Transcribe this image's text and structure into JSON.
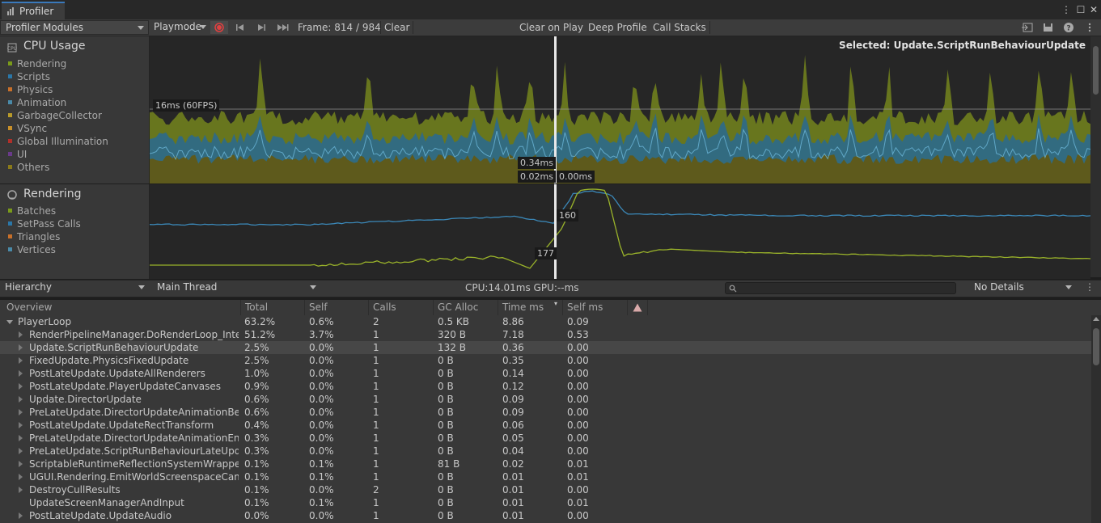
{
  "window": {
    "tab_title": "Profiler"
  },
  "toolbar": {
    "modules_label": "Profiler Modules",
    "mode_label": "Playmode",
    "frame_label": "Frame: 814 / 984",
    "clear_label": "Clear",
    "clear_on_play_label": "Clear on Play",
    "deep_profile_label": "Deep Profile",
    "call_stacks_label": "Call Stacks"
  },
  "cpu_module": {
    "title": "CPU Usage",
    "legend": [
      {
        "label": "Rendering",
        "color": "#7a9a1a"
      },
      {
        "label": "Scripts",
        "color": "#2b77a8"
      },
      {
        "label": "Physics",
        "color": "#c8702a"
      },
      {
        "label": "Animation",
        "color": "#4a8aa8"
      },
      {
        "label": "GarbageCollector",
        "color": "#b89a2a"
      },
      {
        "label": "VSync",
        "color": "#c8902a"
      },
      {
        "label": "Global Illumination",
        "color": "#b0302a"
      },
      {
        "label": "UI",
        "color": "#6a3a8a"
      },
      {
        "label": "Others",
        "color": "#8a7a1a"
      }
    ],
    "selected_label": "Selected: Update.ScriptRunBehaviourUpdate",
    "fps_line_label": "16ms (60FPS)",
    "marker_labels": [
      "0.34ms",
      "0.02ms",
      "0.00ms"
    ]
  },
  "rendering_module": {
    "title": "Rendering",
    "legend": [
      {
        "label": "Batches",
        "color": "#7a9a1a"
      },
      {
        "label": "SetPass Calls",
        "color": "#2b77a8"
      },
      {
        "label": "Triangles",
        "color": "#c8702a"
      },
      {
        "label": "Vertices",
        "color": "#4a8aa8"
      }
    ],
    "marker_labels": [
      "160",
      "177"
    ]
  },
  "hierarchy_toolbar": {
    "view_label": "Hierarchy",
    "thread_label": "Main Thread",
    "timing_label": "CPU:14.01ms  GPU:--ms",
    "details_label": "No Details"
  },
  "table": {
    "columns": [
      "Overview",
      "Total",
      "Self",
      "Calls",
      "GC Alloc",
      "Time ms",
      "Self ms"
    ],
    "rows": [
      {
        "name": "PlayerLoop",
        "total": "63.2%",
        "self": "0.6%",
        "calls": "2",
        "gc": "0.5 KB",
        "time": "8.86",
        "selfms": "0.09",
        "expand": "open",
        "indent": 0
      },
      {
        "name": "RenderPipelineManager.DoRenderLoop_Intern",
        "total": "51.2%",
        "self": "3.7%",
        "calls": "1",
        "gc": "320 B",
        "time": "7.18",
        "selfms": "0.53",
        "expand": "closed",
        "indent": 1
      },
      {
        "name": "Update.ScriptRunBehaviourUpdate",
        "total": "2.5%",
        "self": "0.0%",
        "calls": "1",
        "gc": "132 B",
        "time": "0.36",
        "selfms": "0.00",
        "expand": "closed",
        "indent": 1,
        "selected": true
      },
      {
        "name": "FixedUpdate.PhysicsFixedUpdate",
        "total": "2.5%",
        "self": "0.0%",
        "calls": "1",
        "gc": "0 B",
        "time": "0.35",
        "selfms": "0.00",
        "expand": "closed",
        "indent": 1
      },
      {
        "name": "PostLateUpdate.UpdateAllRenderers",
        "total": "1.0%",
        "self": "0.0%",
        "calls": "1",
        "gc": "0 B",
        "time": "0.14",
        "selfms": "0.00",
        "expand": "closed",
        "indent": 1
      },
      {
        "name": "PostLateUpdate.PlayerUpdateCanvases",
        "total": "0.9%",
        "self": "0.0%",
        "calls": "1",
        "gc": "0 B",
        "time": "0.12",
        "selfms": "0.00",
        "expand": "closed",
        "indent": 1
      },
      {
        "name": "Update.DirectorUpdate",
        "total": "0.6%",
        "self": "0.0%",
        "calls": "1",
        "gc": "0 B",
        "time": "0.09",
        "selfms": "0.00",
        "expand": "closed",
        "indent": 1
      },
      {
        "name": "PreLateUpdate.DirectorUpdateAnimationBegin",
        "total": "0.6%",
        "self": "0.0%",
        "calls": "1",
        "gc": "0 B",
        "time": "0.09",
        "selfms": "0.00",
        "expand": "closed",
        "indent": 1
      },
      {
        "name": "PostLateUpdate.UpdateRectTransform",
        "total": "0.4%",
        "self": "0.0%",
        "calls": "1",
        "gc": "0 B",
        "time": "0.06",
        "selfms": "0.00",
        "expand": "closed",
        "indent": 1
      },
      {
        "name": "PreLateUpdate.DirectorUpdateAnimationEnd",
        "total": "0.3%",
        "self": "0.0%",
        "calls": "1",
        "gc": "0 B",
        "time": "0.05",
        "selfms": "0.00",
        "expand": "closed",
        "indent": 1
      },
      {
        "name": "PreLateUpdate.ScriptRunBehaviourLateUpdate",
        "total": "0.3%",
        "self": "0.0%",
        "calls": "1",
        "gc": "0 B",
        "time": "0.04",
        "selfms": "0.00",
        "expand": "closed",
        "indent": 1
      },
      {
        "name": "ScriptableRuntimeReflectionSystemWrapper.Ir",
        "total": "0.1%",
        "self": "0.1%",
        "calls": "1",
        "gc": "81 B",
        "time": "0.02",
        "selfms": "0.01",
        "expand": "closed",
        "indent": 1
      },
      {
        "name": "UGUI.Rendering.EmitWorldScreenspaceCamer",
        "total": "0.1%",
        "self": "0.1%",
        "calls": "1",
        "gc": "0 B",
        "time": "0.01",
        "selfms": "0.01",
        "expand": "closed",
        "indent": 1
      },
      {
        "name": "DestroyCullResults",
        "total": "0.1%",
        "self": "0.0%",
        "calls": "2",
        "gc": "0 B",
        "time": "0.01",
        "selfms": "0.00",
        "expand": "closed",
        "indent": 1
      },
      {
        "name": "UpdateScreenManagerAndInput",
        "total": "0.1%",
        "self": "0.1%",
        "calls": "1",
        "gc": "0 B",
        "time": "0.01",
        "selfms": "0.01",
        "expand": "none",
        "indent": 1
      },
      {
        "name": "PostLateUpdate.UpdateAudio",
        "total": "0.0%",
        "self": "0.0%",
        "calls": "1",
        "gc": "0 B",
        "time": "0.01",
        "selfms": "0.00",
        "expand": "closed",
        "indent": 1
      }
    ]
  },
  "colors": {
    "rendering_area": "#6b7a1e",
    "scripts_area": "#2f6a86",
    "others_area": "#5e5a1c",
    "batches_line": "#9ab32a",
    "setpass_line": "#3b88b8",
    "selection_line": "#e8e8e8"
  }
}
